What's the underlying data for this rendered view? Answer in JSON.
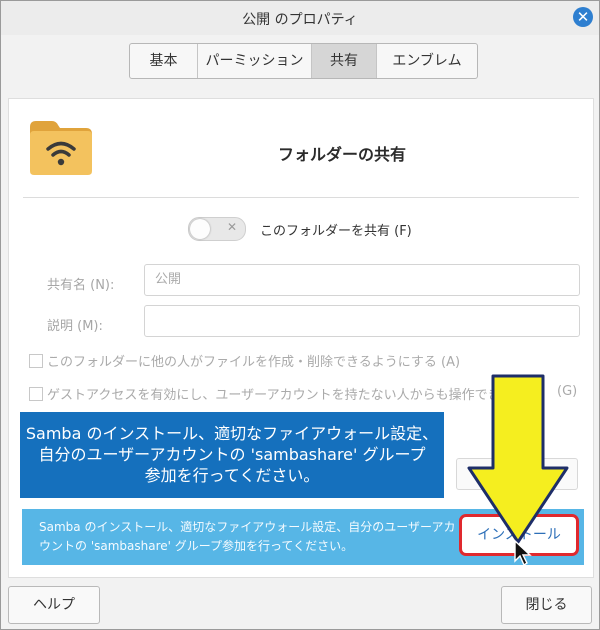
{
  "window": {
    "title": "公開 のプロパティ"
  },
  "tabs": [
    {
      "label": "基本"
    },
    {
      "label": "パーミッション"
    },
    {
      "label": "共有"
    },
    {
      "label": "エンブレム"
    }
  ],
  "share": {
    "heading": "フォルダーの共有",
    "toggle_label": "このフォルダーを共有 (F)",
    "toggle_on": false,
    "share_name_label": "共有名 (N):",
    "share_name_value": "公開",
    "description_label": "説明 (M):",
    "description_value": "",
    "checkbox_allow_others": "このフォルダーに他の人がファイルを作成・削除できるようにする (A)",
    "checkbox_guest": "ゲストアクセスを有効にし、ユーザーアカウントを持たない人からも操作できる",
    "checkbox_guest_shortcut": "(G)"
  },
  "annotation": {
    "banner_lines": [
      "Samba のインストール、適切なファイアウォール設定、",
      "自分のユーザーアカウントの 'sambashare' グループ",
      "参加を行ってください。"
    ],
    "arrow_color": "#f5ee1f"
  },
  "info": {
    "text": "Samba のインストール、適切なファイアウォール設定、自分のユーザーアカウントの 'sambashare' グループ参加を行ってください。",
    "install_label": "インストール"
  },
  "footer": {
    "help_label": "ヘルプ",
    "close_label": "閉じる"
  },
  "colors": {
    "accent": "#2e7fd0",
    "info_bar": "#57b6e6",
    "banner": "#1570bd",
    "highlight": "#e0292e"
  }
}
